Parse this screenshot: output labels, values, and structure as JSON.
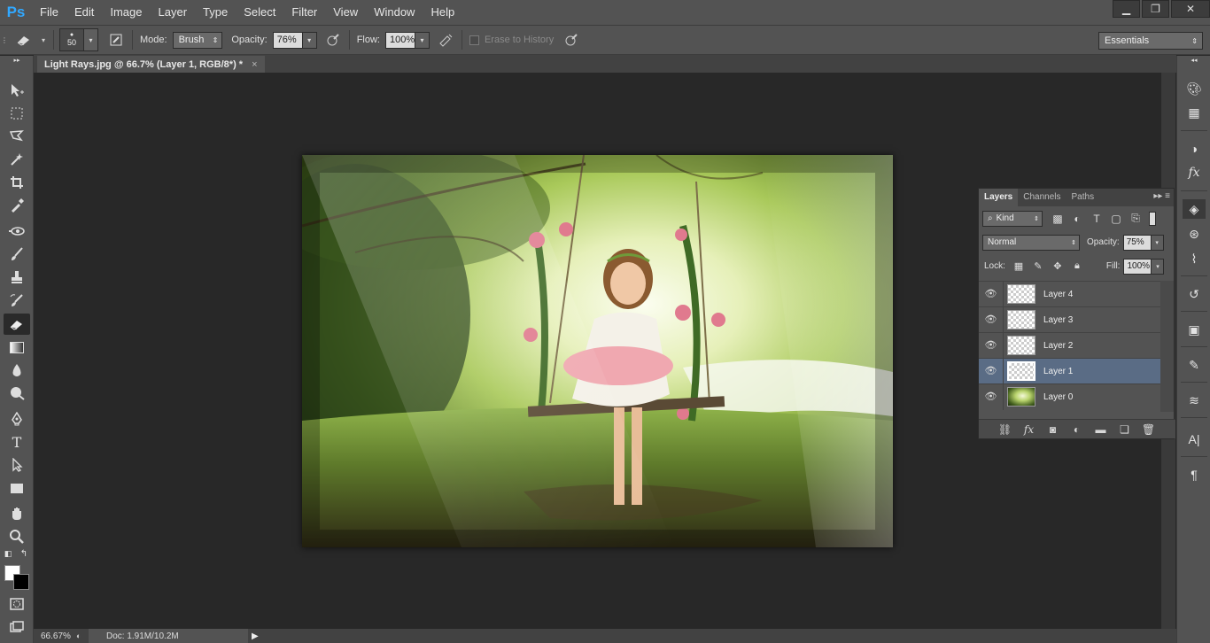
{
  "app": {
    "logo": "Ps",
    "menu": [
      "File",
      "Edit",
      "Image",
      "Layer",
      "Type",
      "Select",
      "Filter",
      "View",
      "Window",
      "Help"
    ],
    "window_controls": [
      "minimize-icon",
      "restore-icon",
      "close-icon"
    ]
  },
  "options_bar": {
    "brush_size": "50",
    "mode_label": "Mode:",
    "mode_value": "Brush",
    "opacity_label": "Opacity:",
    "opacity_value": "76%",
    "flow_label": "Flow:",
    "flow_value": "100%",
    "erase_history_label": "Erase to History",
    "workspace": "Essentials"
  },
  "document": {
    "tab_title": "Light Rays.jpg @ 66.7% (Layer 1, RGB/8*) *",
    "close": "×"
  },
  "status": {
    "zoom": "66.67%",
    "doc_info": "Doc: 1.91M/10.2M"
  },
  "layers_panel": {
    "tabs": [
      "Layers",
      "Channels",
      "Paths"
    ],
    "filter_kind": "Kind",
    "blend_mode": "Normal",
    "opacity_label": "Opacity:",
    "opacity_value": "75%",
    "lock_label": "Lock:",
    "fill_label": "Fill:",
    "fill_value": "100%",
    "layers": [
      {
        "name": "Layer 4",
        "selected": false,
        "thumb": "transparent"
      },
      {
        "name": "Layer 3",
        "selected": false,
        "thumb": "transparent"
      },
      {
        "name": "Layer 2",
        "selected": false,
        "thumb": "transparent"
      },
      {
        "name": "Layer 1",
        "selected": true,
        "thumb": "transparent"
      },
      {
        "name": "Layer 0",
        "selected": false,
        "thumb": "photo"
      }
    ]
  },
  "colors": {
    "foreground": "#ffffff",
    "background": "#000000",
    "selection": "#5a6c85",
    "brand": "#31a8ff"
  }
}
